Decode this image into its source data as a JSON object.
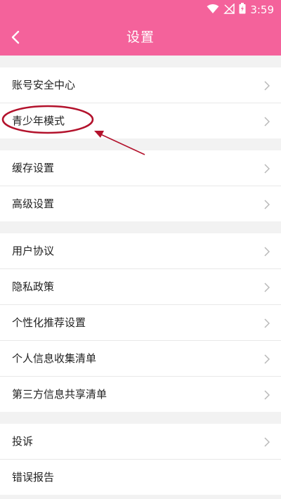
{
  "status": {
    "time": "3:59"
  },
  "header": {
    "title": "设置"
  },
  "groups": [
    {
      "items": [
        {
          "label": "账号安全中心"
        },
        {
          "label": "青少年模式"
        }
      ]
    },
    {
      "items": [
        {
          "label": "缓存设置"
        },
        {
          "label": "高级设置"
        }
      ]
    },
    {
      "items": [
        {
          "label": "用户协议"
        },
        {
          "label": "隐私政策"
        },
        {
          "label": "个性化推荐设置"
        },
        {
          "label": "个人信息收集清单"
        },
        {
          "label": "第三方信息共享清单"
        }
      ]
    },
    {
      "items": [
        {
          "label": "投诉"
        },
        {
          "label": "错误报告"
        }
      ]
    }
  ],
  "colors": {
    "accent": "#f4629b",
    "annotation": "#b3122c"
  }
}
